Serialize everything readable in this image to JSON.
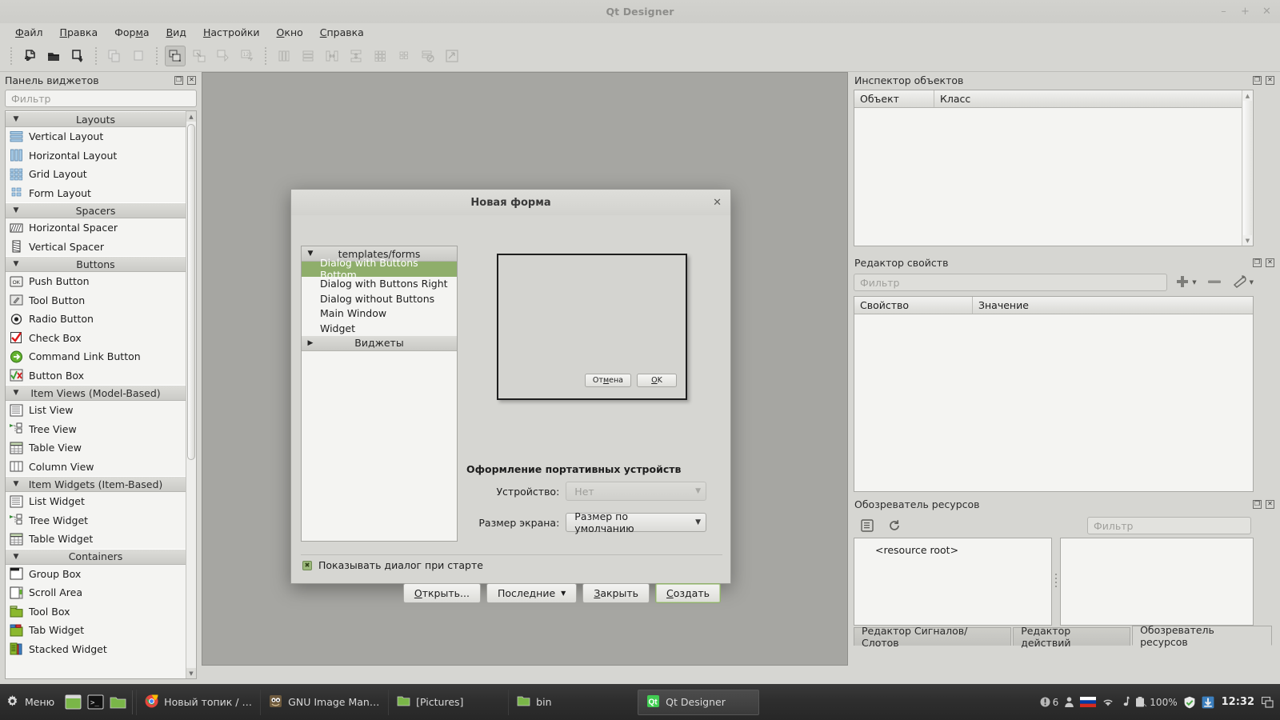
{
  "window": {
    "title": "Qt Designer",
    "controls": {
      "minimize": "–",
      "maximize": "+",
      "close": "✕"
    }
  },
  "menubar": {
    "items": [
      {
        "label": "Файл",
        "accel": "Ф"
      },
      {
        "label": "Правка",
        "accel": "П"
      },
      {
        "label": "Форма",
        "accel": "м"
      },
      {
        "label": "Вид",
        "accel": "В"
      },
      {
        "label": "Настройки",
        "accel": "Н"
      },
      {
        "label": "Окно",
        "accel": "О"
      },
      {
        "label": "Справка",
        "accel": "С"
      }
    ]
  },
  "toolbar": {
    "buttons": [
      {
        "name": "new-form-icon",
        "state": "enabled"
      },
      {
        "name": "open-form-icon",
        "state": "enabled"
      },
      {
        "name": "save-form-icon",
        "state": "enabled"
      },
      {
        "name": "copy-icon",
        "state": "disabled"
      },
      {
        "name": "paste-icon",
        "state": "disabled"
      },
      {
        "name": "edit-widgets-icon",
        "state": "active"
      },
      {
        "name": "edit-signals-slots-icon",
        "state": "disabled"
      },
      {
        "name": "edit-buddies-icon",
        "state": "disabled"
      },
      {
        "name": "edit-tab-order-icon",
        "state": "disabled"
      },
      {
        "name": "layout-horizontal-icon",
        "state": "disabled"
      },
      {
        "name": "layout-vertical-icon",
        "state": "disabled"
      },
      {
        "name": "layout-splitter-horizontal-icon",
        "state": "disabled"
      },
      {
        "name": "layout-splitter-vertical-icon",
        "state": "disabled"
      },
      {
        "name": "layout-grid-icon",
        "state": "disabled"
      },
      {
        "name": "layout-form-icon",
        "state": "disabled"
      },
      {
        "name": "break-layout-icon",
        "state": "disabled"
      },
      {
        "name": "adjust-size-icon",
        "state": "disabled"
      }
    ]
  },
  "widget_box": {
    "title": "Панель виджетов",
    "filter_placeholder": "Фильтр",
    "groups": [
      {
        "label": "Layouts",
        "expanded": true,
        "items": [
          {
            "label": "Vertical Layout",
            "icon": "vertical-layout-icon"
          },
          {
            "label": "Horizontal Layout",
            "icon": "horizontal-layout-icon"
          },
          {
            "label": "Grid Layout",
            "icon": "grid-layout-icon"
          },
          {
            "label": "Form Layout",
            "icon": "form-layout-icon"
          }
        ]
      },
      {
        "label": "Spacers",
        "expanded": true,
        "items": [
          {
            "label": "Horizontal Spacer",
            "icon": "horizontal-spacer-icon"
          },
          {
            "label": "Vertical Spacer",
            "icon": "vertical-spacer-icon"
          }
        ]
      },
      {
        "label": "Buttons",
        "expanded": true,
        "items": [
          {
            "label": "Push Button",
            "icon": "push-button-icon"
          },
          {
            "label": "Tool Button",
            "icon": "tool-button-icon"
          },
          {
            "label": "Radio Button",
            "icon": "radio-button-icon"
          },
          {
            "label": "Check Box",
            "icon": "check-box-icon"
          },
          {
            "label": "Command Link Button",
            "icon": "command-link-button-icon"
          },
          {
            "label": "Button Box",
            "icon": "button-box-icon"
          }
        ]
      },
      {
        "label": "Item Views (Model-Based)",
        "expanded": true,
        "items": [
          {
            "label": "List View",
            "icon": "list-view-icon"
          },
          {
            "label": "Tree View",
            "icon": "tree-view-icon"
          },
          {
            "label": "Table View",
            "icon": "table-view-icon"
          },
          {
            "label": "Column View",
            "icon": "column-view-icon"
          }
        ]
      },
      {
        "label": "Item Widgets (Item-Based)",
        "expanded": true,
        "items": [
          {
            "label": "List Widget",
            "icon": "list-widget-icon"
          },
          {
            "label": "Tree Widget",
            "icon": "tree-widget-icon"
          },
          {
            "label": "Table Widget",
            "icon": "table-widget-icon"
          }
        ]
      },
      {
        "label": "Containers",
        "expanded": true,
        "items": [
          {
            "label": "Group Box",
            "icon": "group-box-icon"
          },
          {
            "label": "Scroll Area",
            "icon": "scroll-area-icon"
          },
          {
            "label": "Tool Box",
            "icon": "tool-box-icon"
          },
          {
            "label": "Tab Widget",
            "icon": "tab-widget-icon"
          },
          {
            "label": "Stacked Widget",
            "icon": "stacked-widget-icon"
          }
        ]
      }
    ]
  },
  "object_inspector": {
    "title": "Инспектор объектов",
    "columns": [
      "Объект",
      "Класс"
    ],
    "rows": []
  },
  "property_editor": {
    "title": "Редактор свойств",
    "filter_placeholder": "Фильтр",
    "columns": [
      "Свойство",
      "Значение"
    ],
    "rows": [],
    "tool_icons": [
      "add-icon",
      "remove-icon",
      "configure-icon"
    ]
  },
  "resource_browser": {
    "title": "Обозреватель ресурсов",
    "filter_placeholder": "Фильтр",
    "tool_icons": [
      "edit-resources-icon",
      "reload-icon"
    ],
    "tree_root": "<resource root>",
    "tabs": [
      {
        "label": "Редактор Сигналов/Слотов",
        "selected": false
      },
      {
        "label": "Редактор действий",
        "selected": false
      },
      {
        "label": "Обозреватель ресурсов",
        "selected": true
      }
    ]
  },
  "new_form_dialog": {
    "title": "Новая форма",
    "close_label": "✕",
    "template_groups": [
      {
        "label": "templates/forms",
        "expanded": true,
        "items": [
          {
            "label": "Dialog with Buttons Bottom",
            "selected": true
          },
          {
            "label": "Dialog with Buttons Right",
            "selected": false
          },
          {
            "label": "Dialog without Buttons",
            "selected": false
          },
          {
            "label": "Main Window",
            "selected": false
          },
          {
            "label": "Widget",
            "selected": false
          }
        ]
      },
      {
        "label": "Виджеты",
        "expanded": false,
        "items": []
      }
    ],
    "preview": {
      "buttons": [
        {
          "label": "Отмена",
          "accel": "м"
        },
        {
          "label": "OK",
          "accel": "O"
        }
      ]
    },
    "embedded_group_title": "Оформление портативных устройств",
    "fields": [
      {
        "label": "Устройство:",
        "value": "Нет",
        "disabled": true
      },
      {
        "label": "Размер экрана:",
        "value": "Размер по умолчанию",
        "disabled": false
      }
    ],
    "show_on_startup": {
      "label": "Показывать диалог при старте",
      "checked": true
    },
    "buttons": [
      {
        "label": "Открыть...",
        "accel": "О",
        "default": false
      },
      {
        "label": "Последние",
        "accel": "",
        "default": false,
        "has_menu": true
      },
      {
        "label": "Закрыть",
        "accel": "З",
        "default": false
      },
      {
        "label": "Создать",
        "accel": "С",
        "default": true
      }
    ]
  },
  "taskbar": {
    "menu_label": "Меню",
    "launchers": [
      "terminal-green-icon",
      "console-icon",
      "file-manager-icon"
    ],
    "tasks": [
      {
        "label": "Новый топик / Хабр...",
        "icon": "chrome-icon",
        "active": false
      },
      {
        "label": "GNU Image Manipul...",
        "icon": "gimp-icon",
        "active": false
      },
      {
        "label": "[Pictures]",
        "icon": "folder-icon",
        "active": false
      },
      {
        "label": "bin",
        "icon": "folder-icon",
        "active": false
      },
      {
        "label": "Qt Designer",
        "icon": "qt-designer-icon",
        "active": true
      }
    ],
    "tray": [
      {
        "name": "notifications-icon",
        "text": "6"
      },
      {
        "name": "user-icon",
        "text": ""
      },
      {
        "name": "keyboard-layout-flag-icon",
        "text": ""
      },
      {
        "name": "wifi-icon",
        "text": ""
      },
      {
        "name": "audio-icon",
        "text": ""
      },
      {
        "name": "battery-icon",
        "text": "100%"
      },
      {
        "name": "shield-icon",
        "text": ""
      },
      {
        "name": "updates-icon",
        "text": ""
      }
    ],
    "clock": "12:32",
    "show_desktop_icon": "show-desktop-icon"
  },
  "colors": {
    "chrome": "#d6d6d2",
    "accent_green": "#8fae6b",
    "canvas": "#a6a6a2",
    "panel_bg": "#f4f4f2",
    "taskbar": "#2e2e2e"
  }
}
